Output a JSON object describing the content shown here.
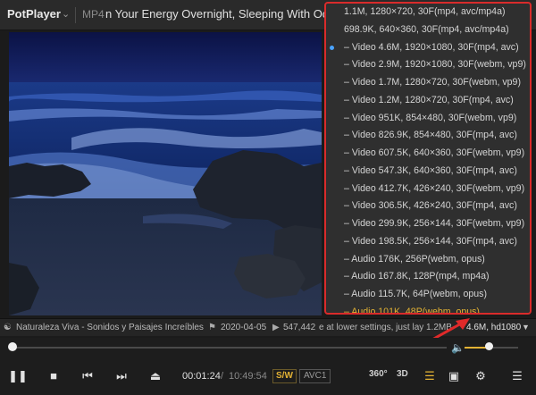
{
  "titlebar": {
    "brand": "PotPlayer",
    "format": "MP4",
    "title": "n Your Energy Overnight, Sleeping With Oce"
  },
  "quality_menu": {
    "items": [
      {
        "label": "1.1M, 1280×720, 30F(mp4, avc/mp4a)"
      },
      {
        "label": "698.9K, 640×360, 30F(mp4, avc/mp4a)"
      },
      {
        "label": "– Video 4.6M, 1920×1080, 30F(mp4, avc)",
        "selected": true
      },
      {
        "label": "– Video 2.9M, 1920×1080, 30F(webm, vp9)"
      },
      {
        "label": "– Video 1.7M, 1280×720, 30F(webm, vp9)"
      },
      {
        "label": "– Video 1.2M, 1280×720, 30F(mp4, avc)"
      },
      {
        "label": "– Video 951K, 854×480, 30F(webm, vp9)"
      },
      {
        "label": "– Video 826.9K, 854×480, 30F(mp4, avc)"
      },
      {
        "label": "– Video 607.5K, 640×360, 30F(webm, vp9)"
      },
      {
        "label": "– Video 547.3K, 640×360, 30F(mp4, avc)"
      },
      {
        "label": "– Video 412.7K, 426×240, 30F(webm, vp9)"
      },
      {
        "label": "– Video 306.5K, 426×240, 30F(mp4, avc)"
      },
      {
        "label": "– Video 299.9K, 256×144, 30F(webm, vp9)"
      },
      {
        "label": "– Video 198.5K, 256×144, 30F(mp4, avc)"
      },
      {
        "label": "– Audio 176K, 256P(webm, opus)"
      },
      {
        "label": "– Audio 167.8K, 128P(mp4, mp4a)"
      },
      {
        "label": "– Audio 115.7K, 64P(webm, opus)"
      },
      {
        "label": "– Audio 101K, 48P(webm, opus)",
        "active": true
      }
    ]
  },
  "infobar": {
    "channel": "Naturaleza Viva - Sonidos y Paisajes Increíbles",
    "date": "2020-04-05",
    "views": "547,442",
    "ticker": "e at lower settings, just lay",
    "size_partial": "1.2MB",
    "quality": "4.6M, hd1080"
  },
  "seek": {
    "progress": 0.0021
  },
  "volume": {
    "level": 0.45
  },
  "controls": {
    "current_time": "00:01:24",
    "separator": "/",
    "total_time": "10:49:54",
    "sw_badge": "S/W",
    "codec_badge": "AVC1",
    "vr_label": "360°",
    "threed_label": "3D"
  },
  "colors": {
    "accent": "#e3b234",
    "highlight_border": "#d92b2b",
    "selected_dot": "#4aa3ff"
  }
}
